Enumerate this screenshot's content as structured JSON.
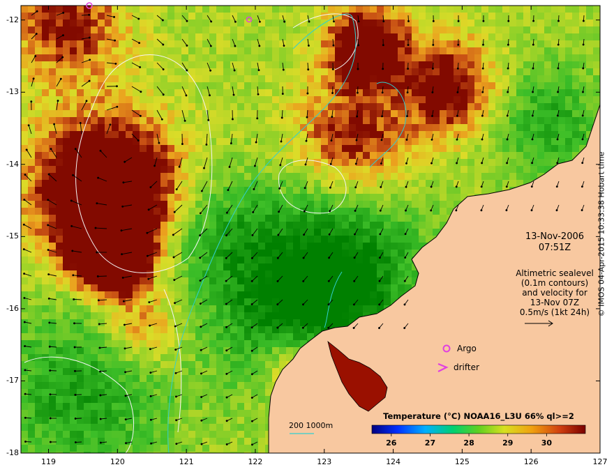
{
  "map": {
    "lon_range": [
      118.6,
      127
    ],
    "lat_range": [
      -18,
      -11.8
    ],
    "lon_ticks": [
      "119",
      "120",
      "121",
      "122",
      "123",
      "124",
      "125",
      "126",
      "127"
    ],
    "lat_ticks": [
      "-12",
      "-13",
      "-14",
      "-15",
      "-16",
      "-17",
      "-18"
    ],
    "land_color": "#f8c8a0"
  },
  "annotations": {
    "date": "13-Nov-2006",
    "time": "07:51Z",
    "desc_lines": [
      "Altimetric sealevel",
      "(0.1m contours)",
      "and velocity for",
      "13-Nov 07Z",
      "0.5m/s (1kt 24h)"
    ]
  },
  "legend": {
    "argo_label": "Argo",
    "drifter_label": "drifter",
    "depth_label": "200  1000m",
    "argo_color": "#e040e0",
    "depth_line_color": "#30d0d0"
  },
  "colorbar": {
    "title": "Temperature (°C) NOAA16_L3U 66% ql>=2",
    "min": 25.5,
    "max": 31.0,
    "ticks": [
      "26",
      "27",
      "28",
      "29",
      "30"
    ]
  },
  "credit": "© IMOS 04-Apr-2015 10:33:38 Hobart time"
}
